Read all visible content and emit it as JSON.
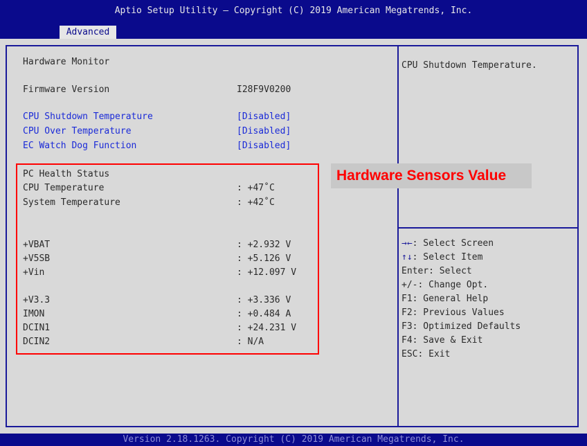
{
  "header": {
    "title": "Aptio Setup Utility – Copyright (C) 2019 American Megatrends, Inc.",
    "tab": "Advanced"
  },
  "main": {
    "section_title": "Hardware Monitor",
    "firmware": {
      "label": "Firmware Version",
      "value": "I28F9V0200"
    },
    "settings": [
      {
        "label": "CPU Shutdown Temperature",
        "value": "[Disabled]"
      },
      {
        "label": "CPU Over Temperature",
        "value": "[Disabled]"
      },
      {
        "label": "EC Watch Dog Function",
        "value": "[Disabled]"
      }
    ],
    "health_title": "PC Health Status",
    "temperatures": [
      {
        "label": "CPU Temperature",
        "value": ": +47˚C"
      },
      {
        "label": "System Temperature",
        "value": ": +42˚C"
      }
    ],
    "voltages": [
      {
        "label": "+VBAT",
        "value": ": +2.932 V"
      },
      {
        "label": "+V5SB",
        "value": ": +5.126 V"
      },
      {
        "label": "+Vin",
        "value": ": +12.097 V"
      },
      {
        "label": "+V3.3",
        "value": ": +3.336 V"
      },
      {
        "label": "IMON",
        "value": ": +0.484 A"
      },
      {
        "label": "DCIN1",
        "value": ": +24.231 V"
      },
      {
        "label": "DCIN2",
        "value": ": N/A"
      }
    ]
  },
  "sidebar": {
    "help": "CPU Shutdown Temperature.",
    "keys": [
      {
        "key": "→←",
        "desc": ": Select Screen"
      },
      {
        "key": "↑↓",
        "desc": ": Select Item"
      },
      {
        "key": "",
        "desc": "Enter: Select"
      },
      {
        "key": "",
        "desc": "+/-: Change Opt."
      },
      {
        "key": "",
        "desc": "F1: General Help"
      },
      {
        "key": "",
        "desc": "F2: Previous Values"
      },
      {
        "key": "",
        "desc": "F3: Optimized Defaults"
      },
      {
        "key": "",
        "desc": "F4: Save & Exit"
      },
      {
        "key": "",
        "desc": "ESC: Exit"
      }
    ]
  },
  "annotation": "Hardware Sensors Value",
  "footer": "Version 2.18.1263. Copyright (C) 2019 American Megatrends, Inc.",
  "colors": {
    "header_bg": "#0a0a8c",
    "panel_bg": "#d9d9d9",
    "option_blue": "#1a2ad8",
    "highlight_red": "#ff0000"
  }
}
